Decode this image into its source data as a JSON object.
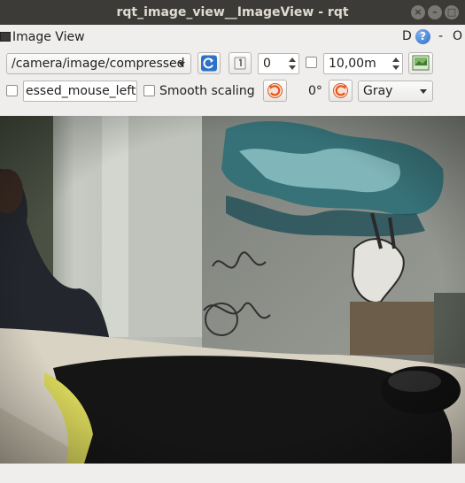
{
  "window": {
    "title": "rqt_image_view__ImageView - rqt"
  },
  "plugin": {
    "title": "Image View",
    "d_label": "D",
    "help_label": "?",
    "minimize_label": "-",
    "close_label": "O"
  },
  "toolbar1": {
    "topic": "/camera/image/compressed",
    "number_value": "0",
    "max_value": "10,00m"
  },
  "toolbar2": {
    "publish_topic": "essed_mouse_left",
    "smooth_scaling_label": "Smooth scaling",
    "smooth_scaling_checked": false,
    "rotation_label": "0°",
    "color_scheme": "Gray"
  },
  "colors": {
    "titlebar": "#3c3b37",
    "window_bg": "#efeeec",
    "accent_orange": "#e2571f",
    "refresh_blue": "#2d72c8"
  },
  "image_view": {
    "content": "fisheye camera photo of a room with graffiti wall and a desk with a mouse"
  }
}
